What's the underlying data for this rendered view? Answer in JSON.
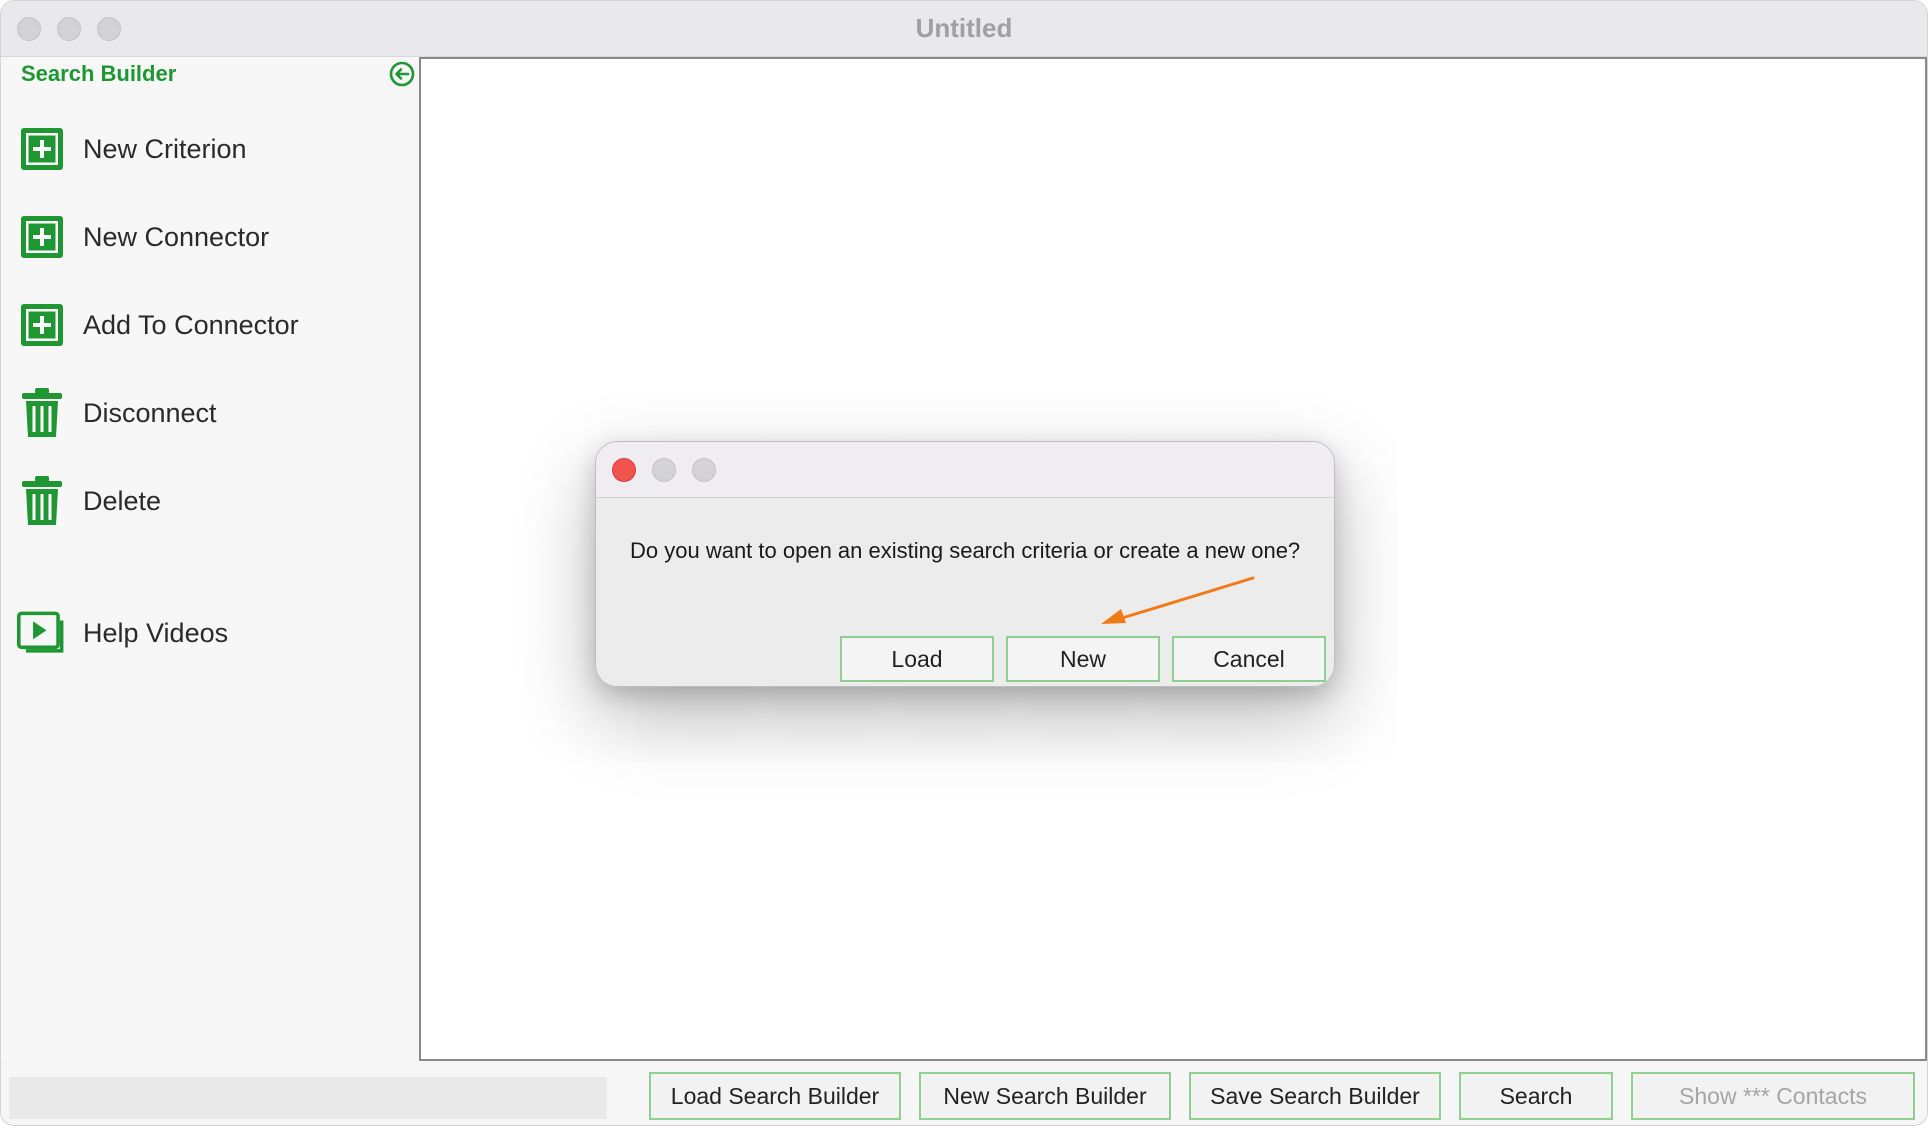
{
  "window": {
    "title": "Untitled"
  },
  "sidebar": {
    "header": "Search Builder",
    "items": [
      {
        "label": "New Criterion",
        "icon": "plus-square-icon"
      },
      {
        "label": "New Connector",
        "icon": "plus-square-icon"
      },
      {
        "label": "Add To Connector",
        "icon": "plus-square-icon"
      },
      {
        "label": "Disconnect",
        "icon": "trash-icon"
      },
      {
        "label": "Delete",
        "icon": "trash-icon"
      },
      {
        "label": "Help Videos",
        "icon": "play-video-icon"
      }
    ]
  },
  "dialog": {
    "message": "Do you want to open an existing search criteria or create a new one?",
    "buttons": {
      "load": "Load",
      "new": "New",
      "cancel": "Cancel"
    }
  },
  "bottom_bar": {
    "load": "Load Search Builder",
    "new": "New Search Builder",
    "save": "Save Search Builder",
    "search": "Search",
    "show_contacts": "Show *** Contacts"
  },
  "colors": {
    "accent_green": "#1e9632",
    "button_border": "#8fd08f",
    "close_red": "#f0524e",
    "annotation_arrow": "#f07a18"
  }
}
